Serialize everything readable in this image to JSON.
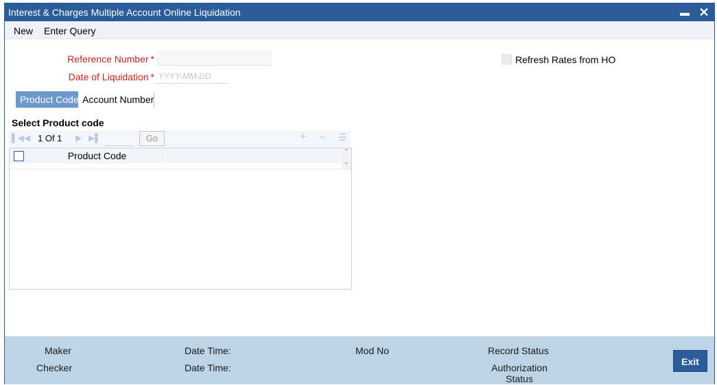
{
  "window": {
    "title": "Interest & Charges Multiple Account Online Liquidation",
    "minimize_icon": "minimize-icon",
    "close_icon": "close-icon"
  },
  "menu": {
    "new_label": "New",
    "enter_query_label": "Enter Query"
  },
  "form": {
    "reference_number_label": "Reference Number",
    "reference_number_value": "",
    "date_of_liquidation_label": "Date of Liquidation",
    "date_of_liquidation_placeholder": "YYYY-MM-DD",
    "required_marker": "*",
    "refresh_rates_label": "Refresh Rates from HO",
    "refresh_rates_checked": false
  },
  "tabs": [
    {
      "label": "Product Code",
      "active": true
    },
    {
      "label": "Account Number",
      "active": false
    }
  ],
  "grid": {
    "section_title": "Select Product code",
    "pagination_text": "1 Of 1",
    "go_label": "Go",
    "columns": [
      "Product Code"
    ],
    "rows": [],
    "toolbar_icons": [
      "first-page-icon",
      "prev-page-icon",
      "next-page-icon",
      "last-page-icon",
      "add-row-icon",
      "delete-row-icon",
      "single-view-icon"
    ]
  },
  "footer": {
    "maker_label": "Maker",
    "checker_label": "Checker",
    "date_time_label_1": "Date Time:",
    "date_time_label_2": "Date Time:",
    "mod_no_label": "Mod No",
    "record_status_label": "Record Status",
    "authorization_status_label": "Authorization Status",
    "exit_label": "Exit"
  },
  "colors": {
    "titlebar": "#2a5c9a",
    "active_tab": "#6d98cc",
    "required_label": "#c4261d",
    "footer": "#bcd4e6"
  }
}
